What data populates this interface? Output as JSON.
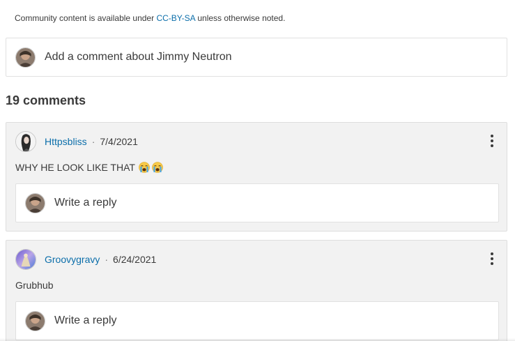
{
  "license": {
    "prefix": "Community content is available under ",
    "link": "CC-BY-SA",
    "suffix": " unless otherwise noted."
  },
  "new_comment": {
    "placeholder": "Add a comment about Jimmy Neutron",
    "avatar_icon": "user-avatar-icon"
  },
  "comments_count": "19 comments",
  "comments": [
    {
      "username": "Httpsbliss",
      "separator": "·",
      "date": "7/4/2021",
      "text": "WHY HE LOOK LIKE THAT",
      "emojis": [
        "crying-face-emoji",
        "crying-face-emoji"
      ],
      "reply_placeholder": "Write a reply"
    },
    {
      "username": "Groovygravy",
      "separator": "·",
      "date": "6/24/2021",
      "text": "Grubhub",
      "emojis": [],
      "reply_placeholder": "Write a reply"
    }
  ],
  "colors": {
    "link": "#0b6eaa",
    "card_bg": "#f2f2f2",
    "border": "#e1e1e1",
    "text": "#3a3a3a"
  }
}
